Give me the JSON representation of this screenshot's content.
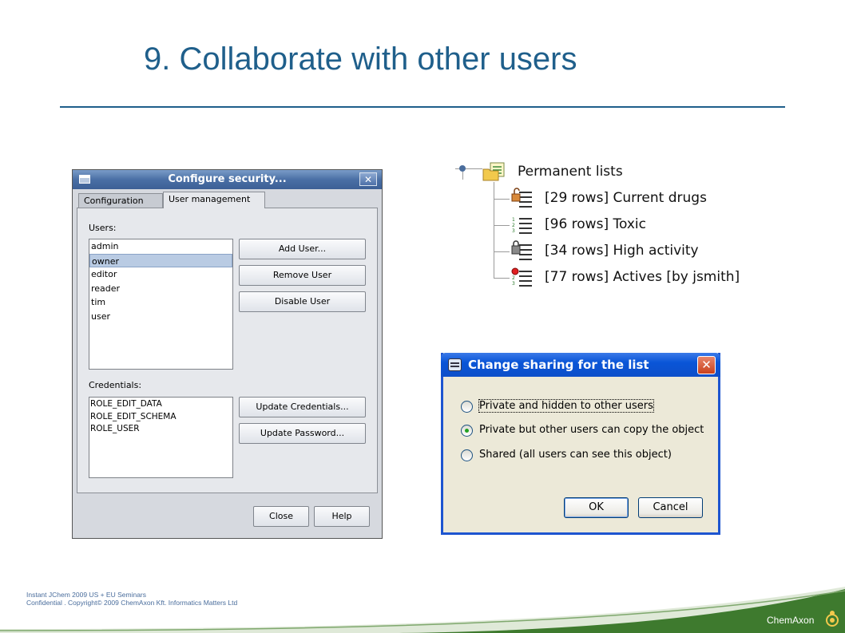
{
  "slide": {
    "title": "9. Collaborate with other users",
    "footer_line1": "Instant JChem 2009 US + EU Seminars",
    "footer_line2": "Confidential . Copyright© 2009 ChemAxon Kft. Informatics Matters Ltd",
    "brand": "ChemAxon"
  },
  "configure_security": {
    "title": "Configure security...",
    "tabs": [
      {
        "label": "Configuration",
        "active": false
      },
      {
        "label": "User management",
        "active": true
      }
    ],
    "users_label": "Users:",
    "users": [
      "admin",
      "owner",
      "editor",
      "reader",
      "tim",
      "user"
    ],
    "selected_user": "owner",
    "credentials_label": "Credentials:",
    "credentials": [
      "ROLE_EDIT_DATA",
      "ROLE_EDIT_SCHEMA",
      "ROLE_USER"
    ],
    "buttons": {
      "add_user": "Add User...",
      "remove_user": "Remove User",
      "disable_user": "Disable User",
      "update_credentials": "Update Credentials...",
      "update_password": "Update Password...",
      "close": "Close",
      "help": "Help"
    }
  },
  "permanent_lists": {
    "root_label": "Permanent lists",
    "items": [
      {
        "label": "[29 rows] Current drugs",
        "icon": "unlocked-list-icon"
      },
      {
        "label": "[96 rows] Toxic",
        "icon": "list-icon"
      },
      {
        "label": "[34 rows] High activity",
        "icon": "locked-list-icon"
      },
      {
        "label": "[77 rows] Actives [by jsmith]",
        "icon": "shared-list-icon"
      }
    ]
  },
  "change_sharing": {
    "title": "Change sharing for the list",
    "options": [
      {
        "label": "Private and hidden to other users",
        "checked": false
      },
      {
        "label": "Private but other users can copy the object",
        "checked": true
      },
      {
        "label": "Shared (all users can see this object)",
        "checked": false
      }
    ],
    "ok": "OK",
    "cancel": "Cancel"
  },
  "colors": {
    "title_blue": "#1f5f8b",
    "xp_title_blue": "#0a55d7",
    "footer_green": "#3e7a2e"
  }
}
